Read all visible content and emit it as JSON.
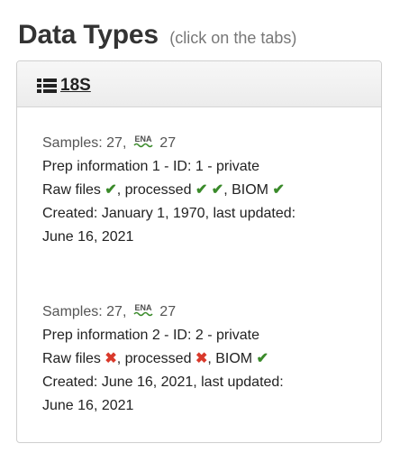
{
  "heading": {
    "title": "Data Types",
    "hint": "(click on the tabs)"
  },
  "tab": {
    "label": "18S",
    "icon": "list-icon"
  },
  "preps": [
    {
      "samples_label": "Samples: 27,",
      "ena_label": "ENA",
      "ena_count": "27",
      "prep_info": "Prep information 1 - ID: 1 - private",
      "raw_label": "Raw files",
      "processed_label": ", processed",
      "biom_label": ", BIOM",
      "created": "Created: January 1, 1970, last updated:",
      "updated": "June 16, 2021"
    },
    {
      "samples_label": "Samples: 27,",
      "ena_label": "ENA",
      "ena_count": "27",
      "prep_info": "Prep information 2 - ID: 2 - private",
      "raw_label": "Raw files",
      "processed_label": ", processed",
      "biom_label": ", BIOM",
      "created": "Created: June 16, 2021, last updated:",
      "updated": "June 16, 2021"
    }
  ],
  "colors": {
    "ok": "#3a8a2a",
    "bad": "#d9392b"
  }
}
